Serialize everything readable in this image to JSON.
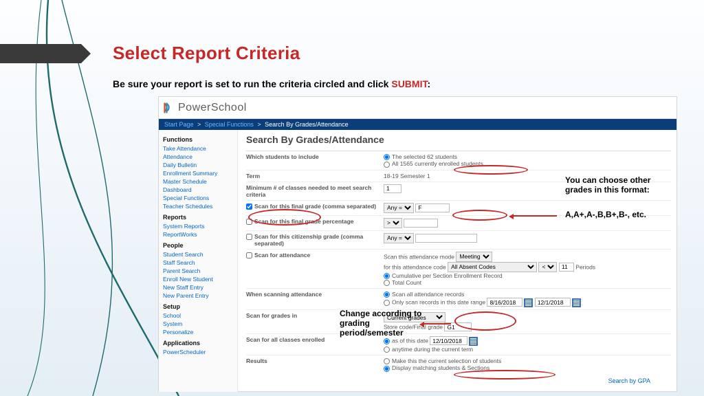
{
  "title": "Select Report Criteria",
  "subtitle_pre": "Be sure your report is set to run the criteria circled and click ",
  "subtitle_bold": "SUBMIT",
  "subtitle_post": ":",
  "ps_brand": "PowerSchool",
  "crumbs": {
    "start": "Start Page",
    "sf": "Special Functions",
    "tail": "Search By Grades/Attendance"
  },
  "sidebar": {
    "h1": "Functions",
    "funcs": [
      "Take Attendance",
      "Attendance",
      "Daily Bulletin",
      "Enrollment Summary",
      "Master Schedule",
      "Dashboard",
      "Special Functions",
      "Teacher Schedules"
    ],
    "h2": "Reports",
    "reports": [
      "System Reports",
      "ReportWorks"
    ],
    "h3": "People",
    "people": [
      "Student Search",
      "Staff Search",
      "Parent Search",
      "Enroll New Student",
      "New Staff Entry",
      "New Parent Entry"
    ],
    "h4": "Setup",
    "setup": [
      "School",
      "System",
      "Personalize"
    ],
    "h5": "Applications",
    "apps": [
      "PowerScheduler"
    ]
  },
  "main": {
    "heading": "Search By Grades/Attendance",
    "row_students": "Which students to include",
    "opt_sel": "The selected 62 students",
    "opt_all": "All 1565 currently enrolled students",
    "row_term": "Term",
    "term_val": "18-19 Semester 1",
    "row_min": "Minimum # of classes needed to meet search criteria",
    "min_val": "1",
    "row_finalgrade": "Scan for this final grade (comma separated)",
    "anyeq": "Any =",
    "grade_val": "F",
    "row_finalpct": "Scan for this final grade percentage",
    "gt": ">",
    "row_citizen": "Scan for this citizenship grade (comma separated)",
    "row_att": "Scan for attendance",
    "att_mode_lbl": "Scan this attendance mode",
    "att_mode": "Meeting",
    "att_code_lbl": "for this attendance code",
    "att_code": "All Absent Codes",
    "att_lt": "<",
    "att_count": "11",
    "periods": "Periods",
    "att_r1": "Cumulative per Section Enrollment Record",
    "att_r2": "Total Count",
    "row_whenatt": "When scanning attendance",
    "whenatt_r1": "Scan all attendance records",
    "whenatt_r2": "Only scan records in this date range",
    "d1": "8/16/2018",
    "d2": "12/1/2018",
    "row_gradesin": "Scan for grades in",
    "gradesin_sel": "Current grades",
    "store_lbl": "Store code/Final grade",
    "store_val": "G1",
    "row_allclasses": "Scan for all classes enrolled",
    "ac_r1": "as of this date",
    "ac_date": "12/10/2018",
    "ac_r2": "anytime during the current term",
    "row_results": "Results",
    "res_r1": "Make this the current selection of students",
    "res_r2": "Display matching students & Sections",
    "gpa_link": "Search by GPA"
  },
  "notes": {
    "right1a": "You can choose other",
    "right1b": "grades in this format:",
    "right2": "A,A+,A-,B,B+,B-, etc.",
    "center1": "Change according to",
    "center2": "grading",
    "center3": "period/semester"
  }
}
